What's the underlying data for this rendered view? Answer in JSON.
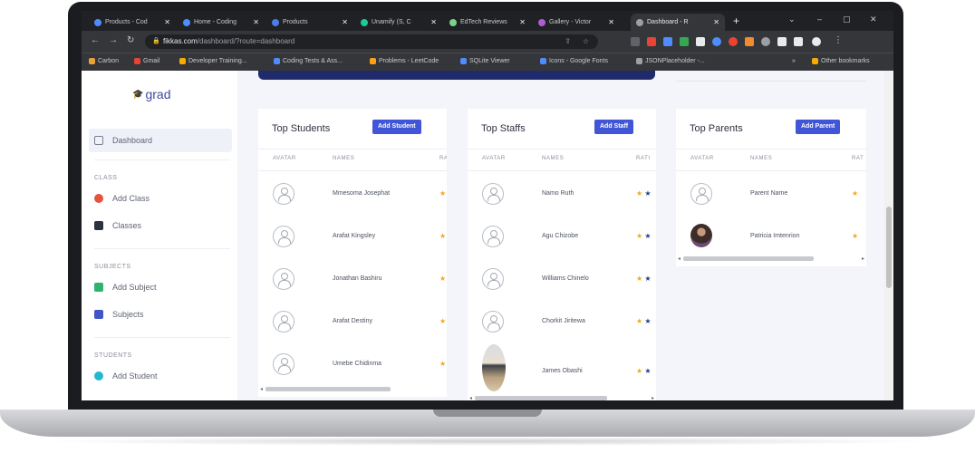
{
  "browser": {
    "tabs": [
      {
        "label": "Products - Cod",
        "color": "#4f8cff"
      },
      {
        "label": "Home - Coding",
        "color": "#4f8cff"
      },
      {
        "label": "Products",
        "color": "#4b7bec"
      },
      {
        "label": "Unamify (S, C",
        "color": "#20c997"
      },
      {
        "label": "EdTech Reviews",
        "color": "#7bd389"
      },
      {
        "label": "Gallery - Victor",
        "color": "#b05cd6"
      },
      {
        "label": "Dashboard - R",
        "color": "#9aa0a6"
      }
    ],
    "new_tab": "+",
    "win_controls": {
      "chevron": "⌄",
      "minimize": "–",
      "maximize": "▢",
      "close": "✕"
    },
    "url_host": "fikkas.com",
    "url_path": "/dashboard/?route=dashboard",
    "bookmarks": [
      {
        "label": "Carbon",
        "color": "#e8a33d"
      },
      {
        "label": "Gmail",
        "color": "#ea4335"
      },
      {
        "label": "Developer Training...",
        "color": "#f9ab00"
      },
      {
        "label": "Coding Tests & Ass...",
        "color": "#4f8cff"
      },
      {
        "label": "Problems - LeetCode",
        "color": "#ffa116"
      },
      {
        "label": "SQLite Viewer",
        "color": "#4f8cff"
      },
      {
        "label": "Icons - Google Fonts",
        "color": "#4f8cff"
      },
      {
        "label": "JSONPlaceholder -...",
        "color": "#9aa0a6"
      },
      {
        "label": "Other bookmarks",
        "color": "#f9ab00"
      }
    ],
    "bookmarks_more": "»"
  },
  "sidebar": {
    "logo": "grad",
    "dashboard": "Dashboard",
    "section_class": "CLASS",
    "add_class": "Add Class",
    "classes": "Classes",
    "section_subjects": "SUBJECTS",
    "add_subject": "Add Subject",
    "subjects": "Subjects",
    "section_students": "STUDENTS",
    "add_student": "Add Student"
  },
  "cards": {
    "students": {
      "title": "Top Students",
      "button": "Add Student",
      "columns": [
        "AVATAR",
        "NAMES",
        "RA"
      ],
      "rows": [
        {
          "name": "Mmesoma Josephat",
          "stars": "★"
        },
        {
          "name": "Arafat Kingsley",
          "stars": "★"
        },
        {
          "name": "Jonathan Bashiru",
          "stars": "★"
        },
        {
          "name": "Arafat Destiny",
          "stars": "★"
        },
        {
          "name": "Umebe Chidinma",
          "stars": "★"
        }
      ]
    },
    "staffs": {
      "title": "Top Staffs",
      "button": "Add Staff",
      "columns": [
        "AVATAR",
        "NAMES",
        "RATI"
      ],
      "rows": [
        {
          "name": "Namo Ruth",
          "stars": "★",
          "stars_dark": "★"
        },
        {
          "name": "Agu Chizobe",
          "stars": "★",
          "stars_dark": "★"
        },
        {
          "name": "Williams Chinelo",
          "stars": "★",
          "stars_dark": "★"
        },
        {
          "name": "Chorkit Jiritewa",
          "stars": "★",
          "stars_dark": "★"
        },
        {
          "name": "James Obashi",
          "stars": "★",
          "stars_dark": "★"
        }
      ]
    },
    "parents": {
      "title": "Top Parents",
      "button": "Add Parent",
      "columns": [
        "AVATAR",
        "NAMES",
        "RAT"
      ],
      "rows": [
        {
          "name": "Parent Name",
          "stars": "★"
        },
        {
          "name": "Patricia Imtenrion",
          "stars": "★"
        }
      ]
    }
  },
  "colors": {
    "accent": "#4056d6",
    "banner": "#1f2b6b",
    "star": "#f3a81d"
  }
}
